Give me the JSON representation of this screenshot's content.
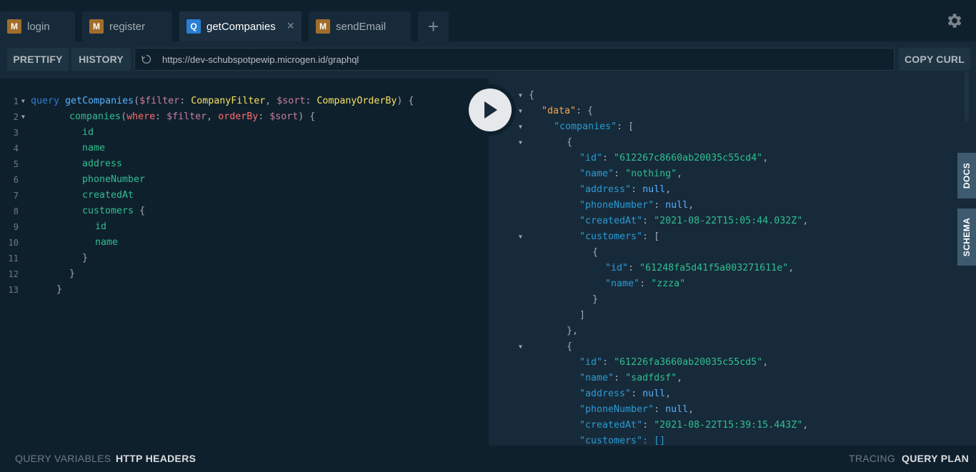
{
  "tabs": [
    {
      "badge": "M",
      "label": "login"
    },
    {
      "badge": "M",
      "label": "register"
    },
    {
      "badge": "Q",
      "label": "getCompanies",
      "close": "×"
    },
    {
      "badge": "M",
      "label": "sendEmail"
    }
  ],
  "add_tab": "+",
  "toolbar": {
    "prettify": "PRETTIFY",
    "history": "HISTORY",
    "url": "https://dev-schubspotpewip.microgen.id/graphql",
    "copy_curl": "COPY CURL"
  },
  "query_lines": [
    "1",
    "2",
    "3",
    "4",
    "5",
    "6",
    "7",
    "8",
    "9",
    "10",
    "11",
    "12",
    "13"
  ],
  "query": {
    "l1": {
      "kw": "query",
      "name": "getCompanies",
      "p1": "(",
      "v1": "$filter",
      "c1": ": ",
      "t1": "CompanyFilter",
      "sep": ", ",
      "v2": "$sort",
      "c2": ": ",
      "t2": "CompanyOrderBy",
      "end": ") {"
    },
    "l2": {
      "fn": "companies",
      "p1": "(",
      "a1": "where",
      "c1": ": ",
      "v1": "$filter",
      "sep": ", ",
      "a2": "orderBy",
      "c2": ": ",
      "v2": "$sort",
      "end": ") {"
    },
    "fields": [
      "id",
      "name",
      "address",
      "phoneNumber",
      "createdAt"
    ],
    "customers": "customers",
    "open": "{",
    "sub_fields": [
      "id",
      "name"
    ],
    "close": "}"
  },
  "result": {
    "data_key": "\"data\"",
    "companies_key": "\"companies\"",
    "c1": {
      "id": "\"612267c8660ab20035c55cd4\"",
      "name": "\"nothing\"",
      "address": "null",
      "phoneNumber": "null",
      "createdAt": "\"2021-08-22T15:05:44.032Z\"",
      "cust_id": "\"61248fa5d41f5a003271611e\"",
      "cust_name": "\"zzza\""
    },
    "c2": {
      "id": "\"61226fa3660ab20035c55cd5\"",
      "name": "\"sadfdsf\"",
      "address": "null",
      "phoneNumber": "null",
      "createdAt": "\"2021-08-22T15:39:15.443Z\"",
      "customers_partial": "\"customers\": []"
    },
    "keys": {
      "id": "\"id\"",
      "name": "\"name\"",
      "address": "\"address\"",
      "phoneNumber": "\"phoneNumber\"",
      "createdAt": "\"createdAt\"",
      "customers": "\"customers\""
    }
  },
  "side": {
    "docs": "DOCS",
    "schema": "SCHEMA"
  },
  "bottom": {
    "query_variables": "QUERY VARIABLES",
    "http_headers": "HTTP HEADERS",
    "tracing": "TRACING",
    "query_plan": "QUERY PLAN"
  },
  "icons": [
    "gear-icon",
    "reload-icon",
    "play-icon",
    "close-icon",
    "plus-icon"
  ]
}
